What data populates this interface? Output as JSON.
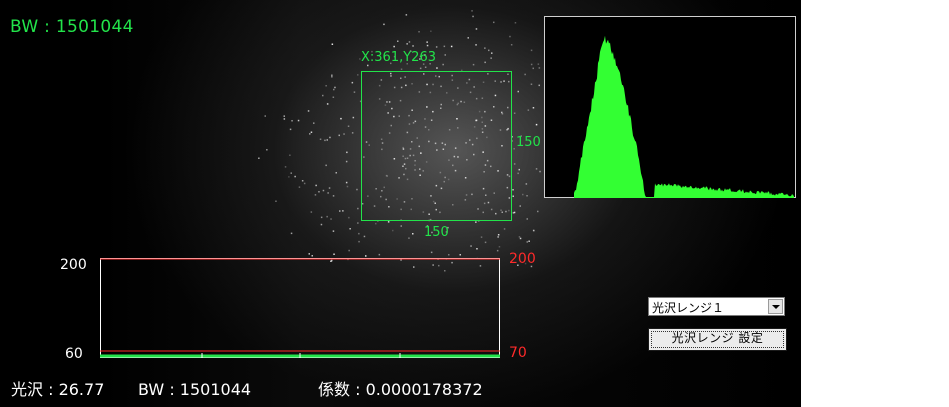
{
  "image_view": {
    "bw_label": "BW : 1501044",
    "roi": {
      "coords_label": "X:361,Y263",
      "width_label": "150",
      "height_label": "150"
    }
  },
  "trend_graph": {
    "left_axis": {
      "max_label": "200",
      "min_label": "60"
    },
    "right_axis": {
      "max_label": "200",
      "min_label": "70"
    },
    "colors": {
      "frame": "#ffffff",
      "reference_line": "#ff2a2a",
      "data_line": "#22e34a"
    }
  },
  "status": {
    "gloss": "光沢 : 26.77",
    "bw": "BW : 1501044",
    "coefficient": "係数 : 0.0000178372"
  },
  "controls": {
    "range_select_value": "光沢レンジ１",
    "set_range_button_label": "光沢レンジ 設定"
  },
  "colors": {
    "overlay_green": "#22e34a",
    "histogram_green": "#33ff33",
    "red": "#ff2a2a",
    "background": "#000000"
  }
}
